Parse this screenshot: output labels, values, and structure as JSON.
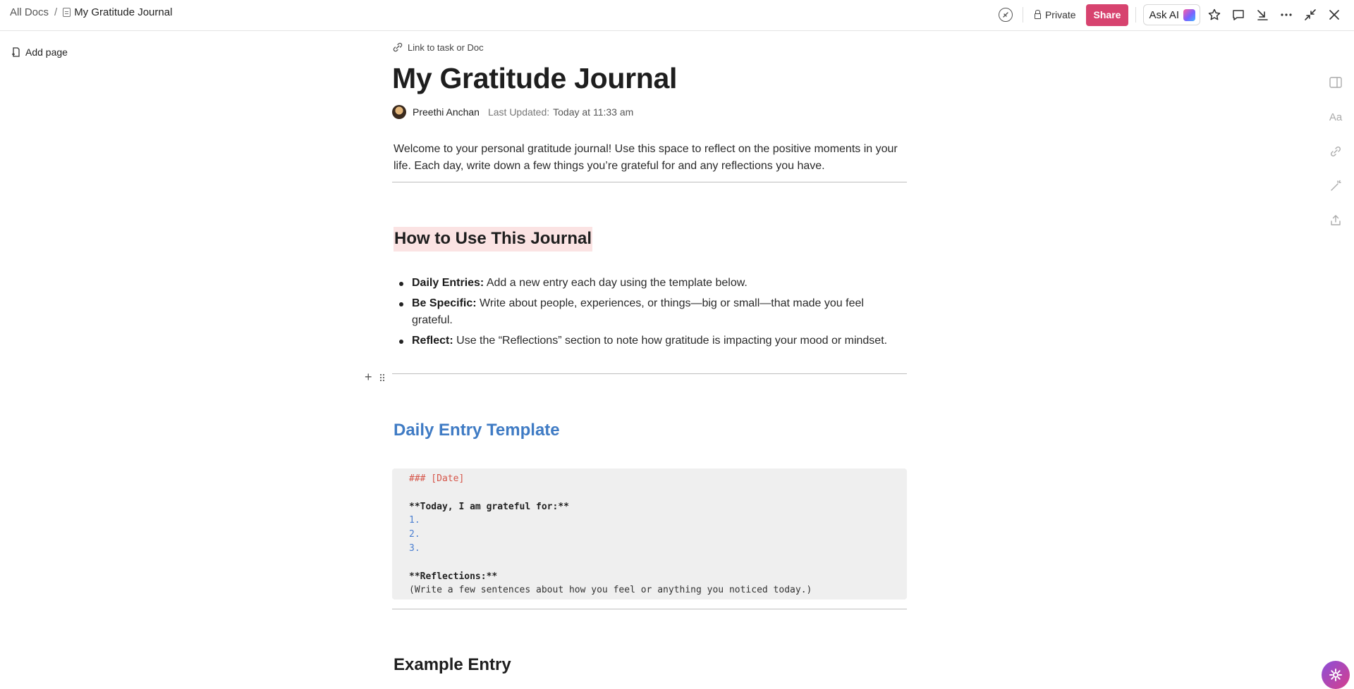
{
  "breadcrumb": {
    "all_docs": "All Docs",
    "separator": "/",
    "current": "My Gratitude Journal"
  },
  "toolbar": {
    "private_label": "Private",
    "share_label": "Share",
    "ask_ai_label": "Ask AI",
    "icons": [
      "tag-icon",
      "star-icon",
      "comment-icon",
      "download-icon",
      "more-icon",
      "collapse-icon",
      "close-icon"
    ],
    "share_color": "#d7436f"
  },
  "sidebar": {
    "add_page_label": "Add page"
  },
  "right_rail": {
    "icons": [
      "panel-icon",
      "text-style-icon",
      "link-icon",
      "magic-wand-icon",
      "export-icon"
    ],
    "text_style_glyph": "Aa"
  },
  "doc": {
    "link_task_label": "Link to task or Doc",
    "title": "My Gratitude Journal",
    "author": "Preethi Anchan",
    "last_updated_label": "Last Updated:",
    "last_updated_value": "Today at 11:33 am",
    "intro": "Welcome to your personal gratitude journal! Use this space to reflect on the positive moments in your life. Each day, write down a few things you’re grateful for and any reflections you have.",
    "section1": {
      "heading": "How to Use This Journal",
      "highlight_color": "#fbe3e3",
      "bullets": [
        {
          "bold": "Daily Entries:",
          "text": " Add a new entry each day using the template below."
        },
        {
          "bold": "Be Specific:",
          "text": " Write about people, experiences, or things—big or small—that made you feel grateful."
        },
        {
          "bold": "Reflect:",
          "text": " Use the “Reflections” section to note how gratitude is impacting your mood or mindset."
        }
      ]
    },
    "section2": {
      "heading": "Daily Entry Template",
      "heading_color": "#3f7bc4",
      "code_lines": [
        "### [Date]",
        "",
        "**Today, I am grateful for:**",
        "1.",
        "2.",
        "3.",
        "",
        "**Reflections:**",
        "(Write a few sentences about how you feel or anything you noticed today.)"
      ]
    },
    "section3": {
      "heading": "Example Entry"
    }
  },
  "block_handle": {
    "plus": "+"
  }
}
